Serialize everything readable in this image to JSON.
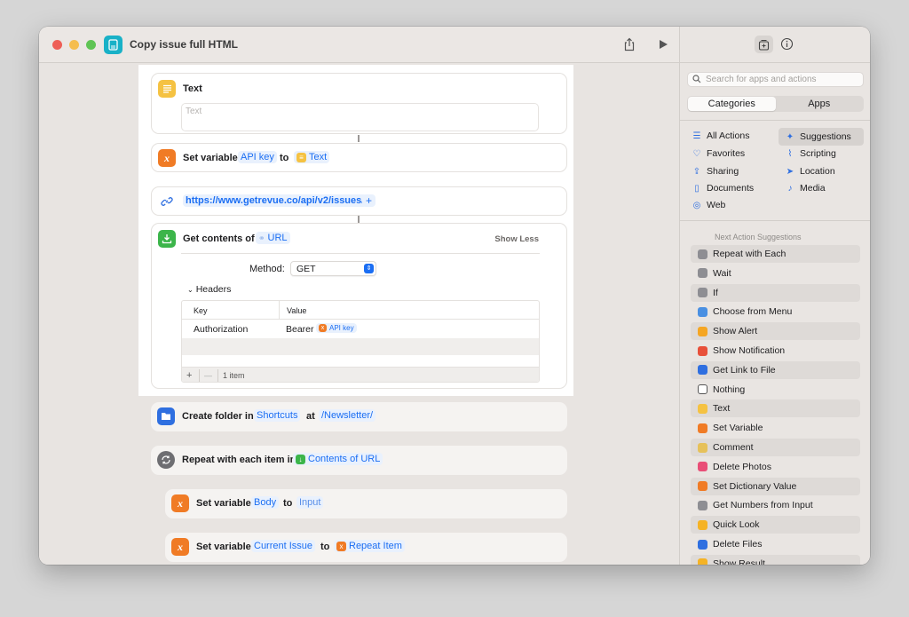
{
  "window": {
    "title": "Copy issue full HTML"
  },
  "editor": {
    "text_action": {
      "label": "Text",
      "placeholder": "Text"
    },
    "set_api": {
      "label": "Set variable",
      "variable": "API key",
      "to": "to",
      "value": "Text"
    },
    "url_action": {
      "url": "https://www.getrevue.co/api/v2/issues/",
      "plus": "+"
    },
    "get_contents": {
      "label": "Get contents of",
      "input": "URL",
      "toggle": "Show Less",
      "method_label": "Method:",
      "method_value": "GET",
      "headers_label": "Headers",
      "table": {
        "col_key": "Key",
        "col_value": "Value",
        "rows": [
          {
            "key": "Authorization",
            "value_prefix": "Bearer",
            "value_token": "API key"
          }
        ]
      },
      "footer_plus": "+",
      "footer_minus": "—",
      "count": "1 item"
    },
    "create_folder": {
      "label": "Create folder in",
      "folder": "Shortcuts",
      "at": "at",
      "path": "/Newsletter/"
    },
    "repeat": {
      "label": "Repeat with each item in",
      "input": "Contents of URL"
    },
    "set_body": {
      "label": "Set variable",
      "variable": "Body",
      "to": "to",
      "value": "Input"
    },
    "set_issue": {
      "label": "Set variable",
      "variable": "Current Issue",
      "to": "to",
      "value": "Repeat Item"
    }
  },
  "sidebar": {
    "search_placeholder": "Search for apps and actions",
    "tabs": [
      "Categories",
      "Apps"
    ],
    "categories": [
      {
        "label": "All Actions",
        "icon": "list-icon"
      },
      {
        "label": "Suggestions",
        "icon": "sparkle-icon"
      },
      {
        "label": "Favorites",
        "icon": "heart-icon"
      },
      {
        "label": "Scripting",
        "icon": "scripting-icon"
      },
      {
        "label": "Sharing",
        "icon": "share-icon"
      },
      {
        "label": "Location",
        "icon": "location-icon"
      },
      {
        "label": "Documents",
        "icon": "document-icon"
      },
      {
        "label": "Media",
        "icon": "music-icon"
      },
      {
        "label": "Web",
        "icon": "compass-icon"
      }
    ],
    "suggestions_header": "Next Action Suggestions",
    "suggestions": [
      {
        "label": "Repeat with Each",
        "color": "#8e8e93"
      },
      {
        "label": "Wait",
        "color": "#8e8e93"
      },
      {
        "label": "If",
        "color": "#8e8e93"
      },
      {
        "label": "Choose from Menu",
        "color": "#4a90e2"
      },
      {
        "label": "Show Alert",
        "color": "#f5a623"
      },
      {
        "label": "Show Notification",
        "color": "#e8503a"
      },
      {
        "label": "Get Link to File",
        "color": "#2f6fe0"
      },
      {
        "label": "Nothing",
        "color": "#ffffff"
      },
      {
        "label": "Text",
        "color": "#f5c242"
      },
      {
        "label": "Set Variable",
        "color": "#f07b25"
      },
      {
        "label": "Comment",
        "color": "#e6c15a"
      },
      {
        "label": "Delete Photos",
        "color": "#e94e77"
      },
      {
        "label": "Set Dictionary Value",
        "color": "#f07b25"
      },
      {
        "label": "Get Numbers from Input",
        "color": "#8e8e93"
      },
      {
        "label": "Quick Look",
        "color": "#f5b325"
      },
      {
        "label": "Delete Files",
        "color": "#2f6fe0"
      },
      {
        "label": "Show Result",
        "color": "#f5b325"
      }
    ]
  },
  "colors": {
    "accent": "#1b6ef3",
    "variable": "#f07b25",
    "text_icon": "#f5c242",
    "link": "#2f6fe0",
    "download": "#3cb54a"
  }
}
